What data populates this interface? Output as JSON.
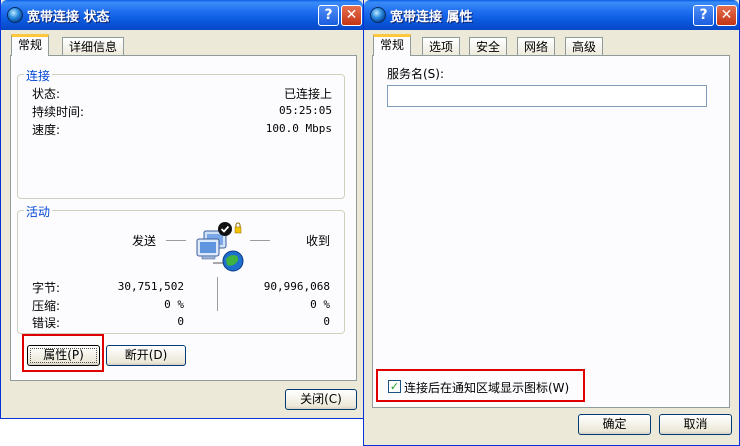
{
  "status_window": {
    "title": "宽带连接 状态",
    "help": "?",
    "close": "✕",
    "tabs": [
      "常规",
      "详细信息"
    ],
    "connection": {
      "legend": "连接",
      "rows": [
        {
          "label": "状态:",
          "value": "已连接上"
        },
        {
          "label": "持续时间:",
          "value": "05:25:05"
        },
        {
          "label": "速度:",
          "value": "100.0 Mbps"
        }
      ]
    },
    "activity": {
      "legend": "活动",
      "sent": "发送",
      "received": "收到",
      "rows": [
        {
          "label": "字节:",
          "sent": "30,751,502",
          "received": "90,996,068"
        },
        {
          "label": "压缩:",
          "sent": "0 %",
          "received": "0 %"
        },
        {
          "label": "错误:",
          "sent": "0",
          "received": "0"
        }
      ]
    },
    "buttons": {
      "properties": "属性(P)",
      "disconnect": "断开(D)",
      "close": "关闭(C)"
    }
  },
  "properties_window": {
    "title": "宽带连接 属性",
    "help": "?",
    "close": "✕",
    "tabs": [
      "常规",
      "选项",
      "安全",
      "网络",
      "高级"
    ],
    "service_name_label": "服务名(S):",
    "service_name_value": "",
    "show_icon_label": "连接后在通知区域显示图标(W)",
    "show_icon_checked": true,
    "ok": "确定",
    "cancel": "取消"
  }
}
